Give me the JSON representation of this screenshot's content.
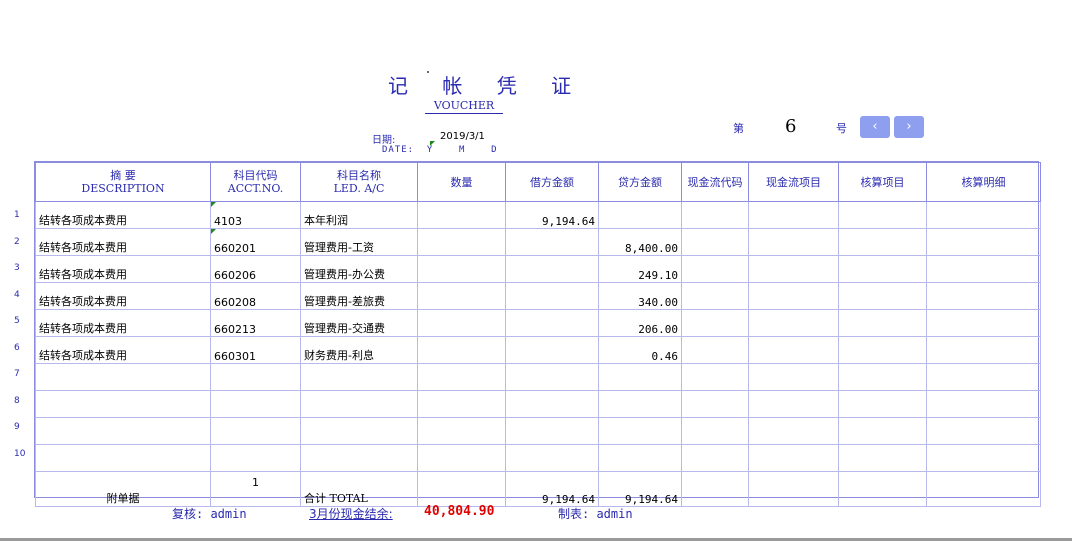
{
  "title": "记 帐 凭 证",
  "subtitle": "VOUCHER",
  "date": {
    "label": "日期:",
    "value": "2019/3/1",
    "label_en": "DATE:  Y    M    D"
  },
  "number": {
    "prefix": "第",
    "value": "6",
    "suffix": "号"
  },
  "nav": {
    "prev": "‹",
    "next": "›"
  },
  "headers": {
    "desc": "摘      要",
    "desc_en": "DESCRIPTION",
    "acct": "科目代码",
    "acct_en": "ACCT.NO.",
    "led": "科目名称",
    "led_en": "LED. A/C",
    "qty": "数量",
    "debit": "借方金额",
    "credit": "贷方金额",
    "cash_code": "现金流代码",
    "cash_item": "现金流项目",
    "acc_item": "核算项目",
    "acc_detail": "核算明细"
  },
  "row_numbers": [
    "1",
    "2",
    "3",
    "4",
    "5",
    "6",
    "7",
    "8",
    "9",
    "10"
  ],
  "rows": [
    {
      "desc": "结转各项成本费用",
      "acct": "4103",
      "led": "本年利润",
      "debit": "9,194.64",
      "credit": ""
    },
    {
      "desc": "结转各项成本费用",
      "acct": "660201",
      "led": "管理费用-工资",
      "debit": "",
      "credit": "8,400.00"
    },
    {
      "desc": "结转各项成本费用",
      "acct": "660206",
      "led": "管理费用-办公费",
      "debit": "",
      "credit": "249.10"
    },
    {
      "desc": "结转各项成本费用",
      "acct": "660208",
      "led": "管理费用-差旅费",
      "debit": "",
      "credit": "340.00"
    },
    {
      "desc": "结转各项成本费用",
      "acct": "660213",
      "led": "管理费用-交通费",
      "debit": "",
      "credit": "206.00"
    },
    {
      "desc": "结转各项成本费用",
      "acct": "660301",
      "led": "财务费用-利息",
      "debit": "",
      "credit": "0.46"
    }
  ],
  "total": {
    "attachments_label": "附单据",
    "attachments_count": "1",
    "label": "合计  TOTAL",
    "debit": "9,194.64",
    "credit": "9,194.64"
  },
  "footer": {
    "reviewer": "复核: admin",
    "balance_label": "3月份现金结余:",
    "balance_value": "40,804.90",
    "maker": "制表: admin"
  },
  "colors": {
    "accent": "#2b2bb0",
    "border": "#8c8ce0",
    "button": "#8f9ff0",
    "negative": "#e00000"
  }
}
